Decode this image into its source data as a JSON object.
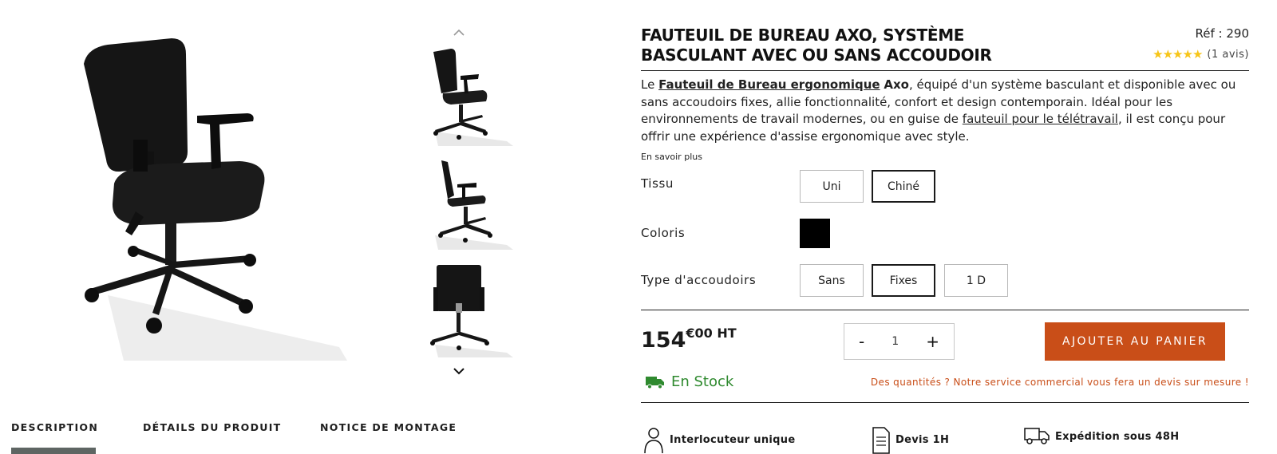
{
  "product": {
    "title": "FAUTEUIL DE BUREAU AXO, SYSTÈME BASCULANT AVEC OU SANS ACCOUDOIR",
    "reference": "Réf : 290",
    "rating": 5,
    "review_count": "(1 avis)",
    "description": {
      "p1": "Le ",
      "link1": "Fauteuil de Bureau ergonomique",
      "p2": " ",
      "bold1": "Axo",
      "p3": ", équipé d'un système basculant et disponible avec ou sans accoudoirs fixes, allie fonctionnalité, confort et design contemporain. Idéal pour les environnements de travail modernes, ou en guise de ",
      "link2": "fauteuil pour le télétravail",
      "p4": ", il est conçu pour offrir une expérience d'assise ergonomique avec style."
    },
    "read_more": "En savoir plus"
  },
  "options": {
    "fabric": {
      "label": "Tissu",
      "values": [
        "Uni",
        "Chiné"
      ],
      "selected": "Chiné"
    },
    "color": {
      "label": "Coloris",
      "swatch": "#000000"
    },
    "armrest": {
      "label": "Type d'accoudoirs",
      "values": [
        "Sans",
        "Fixes",
        "1 D"
      ],
      "selected": "Fixes"
    }
  },
  "purchase": {
    "price_int": "154",
    "price_dec": "€00 HT",
    "quantity": "1",
    "minus": "-",
    "plus": "+",
    "add_to_cart": "AJOUTER AU PANIER",
    "stock": "En Stock",
    "quote_message": "Des quantités ? Notre service commercial vous fera un devis sur mesure !"
  },
  "features": [
    "Interlocuteur unique",
    "Devis 1H",
    "Expédition sous 48H"
  ],
  "tabs": [
    "DESCRIPTION",
    "DÉTAILS DU PRODUIT",
    "NOTICE DE MONTAGE"
  ],
  "colors": {
    "accent": "#c94e18",
    "stock_green": "#2f8a2f",
    "stars": "#f7c518"
  }
}
